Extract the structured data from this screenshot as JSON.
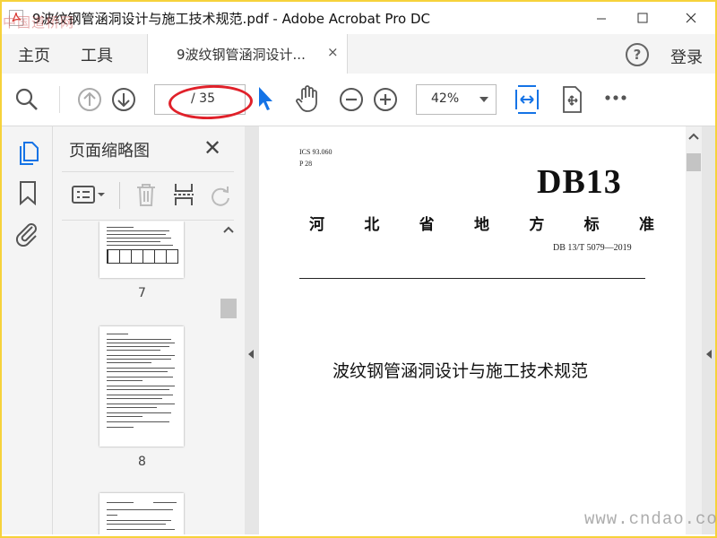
{
  "window": {
    "title": "9波纹钢管涵洞设计与施工技术规范.pdf - Adobe Acrobat Pro DC",
    "minimize_icon": "minimize-icon",
    "maximize_icon": "maximize-icon",
    "close_icon": "close-icon"
  },
  "watermark_top": "中国道桥网",
  "tabs": {
    "home": "主页",
    "tools": "工具",
    "document": "9波纹钢管涵洞设计...",
    "close": "×"
  },
  "account": {
    "help": "?",
    "login": "登录"
  },
  "toolbar": {
    "current_page": "",
    "total_pages": "/ 35",
    "zoom": "42%",
    "icons": [
      "search-icon",
      "page-up-icon",
      "page-down-icon",
      "select-cursor-icon",
      "hand-icon",
      "zoom-out-icon",
      "zoom-in-icon",
      "fit-width-icon",
      "scroll-mode-icon",
      "more-icon"
    ]
  },
  "panel": {
    "title": "页面缩略图",
    "close": "✕",
    "thumbnails": [
      {
        "page": "7"
      },
      {
        "page": "8"
      },
      {
        "page": ""
      }
    ]
  },
  "document": {
    "ics": "ICS 93.060",
    "p_code": "P 28",
    "db": "DB13",
    "standard_name": [
      "河",
      "北",
      "省",
      "地",
      "方",
      "标",
      "准"
    ],
    "standard_code": "DB 13/T 5079—2019",
    "title": "波纹钢管涵洞设计与施工技术规范"
  },
  "watermark_bottom": "www.cndao.com",
  "colors": {
    "accent": "#1473e6",
    "annotation": "#e0212a",
    "frame": "#f6d23b"
  }
}
